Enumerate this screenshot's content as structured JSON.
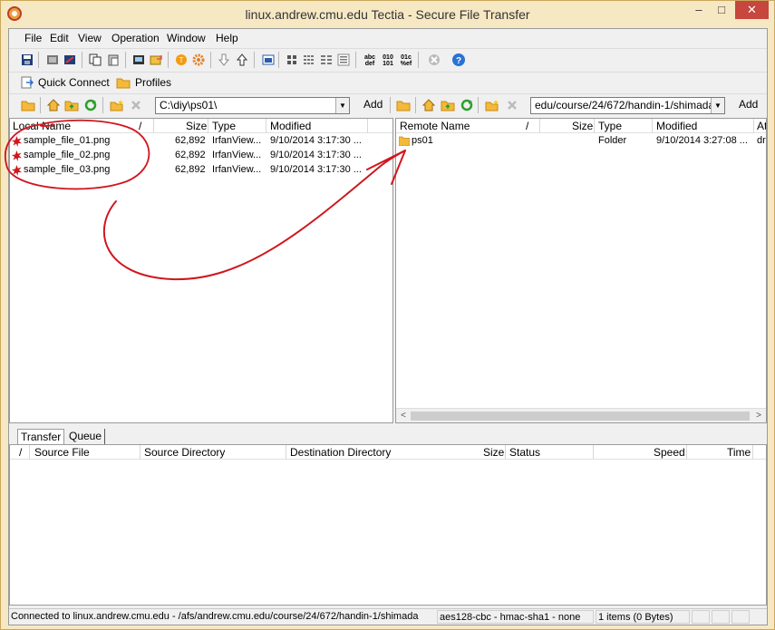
{
  "window": {
    "title": "linux.andrew.cmu.edu Tectia - Secure File Transfer",
    "minimize": "–",
    "maximize": "□",
    "close": "✕"
  },
  "menu": [
    "File",
    "Edit",
    "View",
    "Operation",
    "Window",
    "Help"
  ],
  "quick": {
    "connect": "Quick Connect",
    "profiles": "Profiles"
  },
  "local": {
    "path": "C:\\diy\\ps01\\",
    "add": "Add",
    "columns": {
      "name": "Local Name",
      "sort": "/",
      "size": "Size",
      "type": "Type",
      "modified": "Modified"
    },
    "files": [
      {
        "name": "sample_file_01.png",
        "size": "62,892",
        "type": "IrfanView...",
        "modified": "9/10/2014 3:17:30 ..."
      },
      {
        "name": "sample_file_02.png",
        "size": "62,892",
        "type": "IrfanView...",
        "modified": "9/10/2014 3:17:30 ..."
      },
      {
        "name": "sample_file_03.png",
        "size": "62,892",
        "type": "IrfanView...",
        "modified": "9/10/2014 3:17:30 ..."
      }
    ]
  },
  "remote": {
    "path": "edu/course/24/672/handin-1/shimada",
    "add": "Add",
    "columns": {
      "name": "Remote Name",
      "sort": "/",
      "size": "Size",
      "type": "Type",
      "modified": "Modified",
      "attr": "At"
    },
    "files": [
      {
        "name": "ps01",
        "size": "",
        "type": "Folder",
        "modified": "9/10/2014 3:27:08 ...",
        "attr": "dr"
      }
    ]
  },
  "tabs": {
    "transfer": "Transfer",
    "queue": "Queue"
  },
  "transfer_columns": {
    "sort": "/",
    "source_file": "Source File",
    "source_dir": "Source Directory",
    "dest_dir": "Destination Directory",
    "size": "Size",
    "status": "Status",
    "speed": "Speed",
    "time": "Time"
  },
  "status": {
    "connection": "Connected to linux.andrew.cmu.edu - /afs/andrew.cmu.edu/course/24/672/handin-1/shimada",
    "cipher": "aes128-cbc - hmac-sha1 - none",
    "items": "1 items (0 Bytes)"
  },
  "icons": {
    "toolbar1": [
      "save-icon",
      "disconnect-icon",
      "new-connection-icon",
      "copy-icon",
      "paste-icon",
      "terminal-icon",
      "new-window-icon",
      "settings-icon",
      "gear-icon",
      "download-icon",
      "upload-icon",
      "view-icon",
      "large-icons-icon",
      "small-icons-icon",
      "list-icon",
      "details-icon",
      "ascii-icon",
      "binary-icon",
      "auto-icon",
      "stop-icon",
      "help-icon"
    ]
  },
  "colors": {
    "window_frame": "#f7e8c4",
    "close_button": "#c7463e",
    "annotation": "#d0161e"
  }
}
